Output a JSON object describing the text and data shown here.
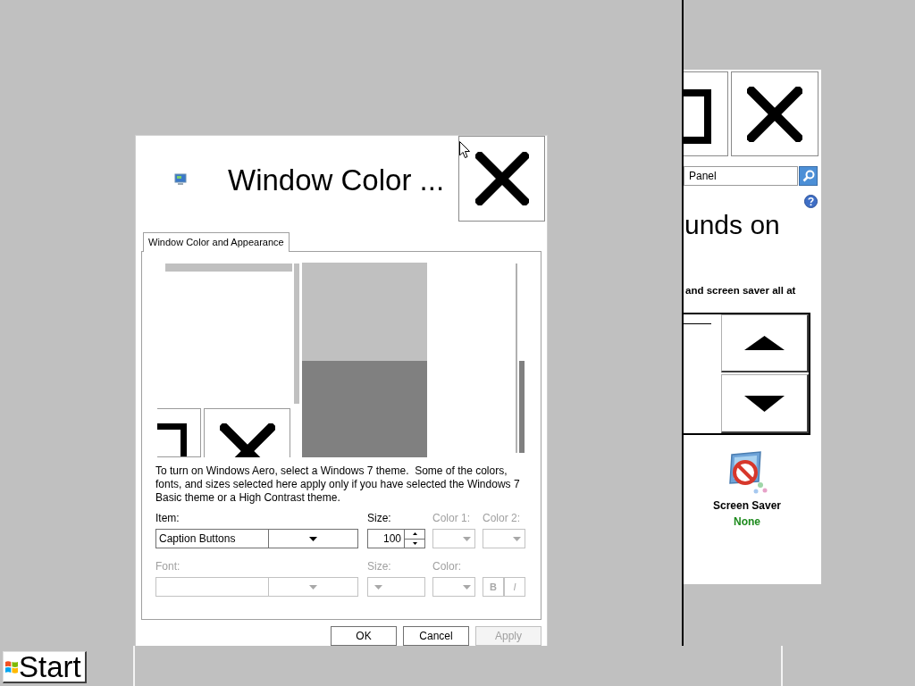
{
  "background_window": {
    "search": {
      "value": "Panel"
    },
    "heading": "unds on",
    "description": "and screen saver all at",
    "screen_saver": {
      "label": "Screen Saver",
      "value": "None"
    }
  },
  "dialog": {
    "title": "Window Color ...",
    "tabs": [
      {
        "label": "Window Color and Appearance",
        "selected": true
      }
    ],
    "info_text": "To turn on Windows Aero, select a Windows 7 theme.  Some of the colors, fonts, and sizes selected here apply only if you have selected the Windows 7 Basic theme or a High Contrast theme.",
    "rows": [
      {
        "fields": [
          {
            "kind": "combo",
            "label": "Item:",
            "value": "Caption Buttons",
            "disabled": false
          },
          {
            "kind": "spinner",
            "label": "Size:",
            "value": "100",
            "disabled": false
          },
          {
            "kind": "color",
            "label": "Color 1:",
            "disabled": true
          },
          {
            "kind": "color",
            "label": "Color 2:",
            "disabled": true
          }
        ]
      },
      {
        "fields": [
          {
            "kind": "combo",
            "label": "Font:",
            "disabled": true
          },
          {
            "kind": "size_combo",
            "label": "Size:",
            "disabled": true
          },
          {
            "kind": "color",
            "label": "Color:",
            "disabled": true
          },
          {
            "kind": "style_buttons",
            "buttons": [
              {
                "kind": "bold",
                "label": "B",
                "disabled": true
              },
              {
                "kind": "italic",
                "label": "I",
                "disabled": true
              }
            ]
          }
        ]
      }
    ],
    "buttons": [
      {
        "label": "OK",
        "disabled": false
      },
      {
        "label": "Cancel",
        "disabled": false
      },
      {
        "label": "Apply",
        "disabled": true
      }
    ]
  },
  "taskbar": {
    "start_label": "Start"
  }
}
